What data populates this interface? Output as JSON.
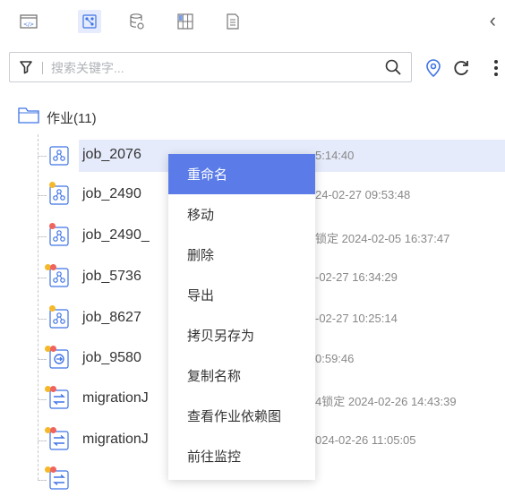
{
  "toolbar": {
    "tabs": [
      {
        "icon": "code-window-icon"
      },
      {
        "icon": "workflow-icon",
        "active": true
      },
      {
        "icon": "database-icon"
      },
      {
        "icon": "grid-table-icon"
      },
      {
        "icon": "document-icon"
      }
    ],
    "collapse_glyph": "‹"
  },
  "search": {
    "placeholder": "搜索关键字..."
  },
  "folder": {
    "label": "作业(11)"
  },
  "jobs": [
    {
      "name": "job_2076",
      "meta": "5:14:40",
      "icon": "workflow-icon",
      "badges": [],
      "selected": true
    },
    {
      "name": "job_2490",
      "meta": "24-02-27 09:53:48",
      "icon": "workflow-icon",
      "badges": [
        "#f5b82a"
      ]
    },
    {
      "name": "job_2490_",
      "meta": "锁定  2024-02-05 16:37:47",
      "icon": "workflow-icon",
      "badges": [
        "#f0645e"
      ]
    },
    {
      "name": "job_5736",
      "meta": "-02-27 16:34:29",
      "icon": "workflow-icon",
      "badges": [
        "#f5b82a",
        "#f0645e"
      ]
    },
    {
      "name": "job_8627",
      "meta": "-02-27 10:25:14",
      "icon": "workflow-icon",
      "badges": [
        "#f5b82a"
      ]
    },
    {
      "name": "job_9580",
      "meta": "0:59:46",
      "icon": "realtime-icon",
      "badges": [
        "#f5b82a",
        "#f0645e"
      ]
    },
    {
      "name": "migrationJ",
      "meta": "4锁定  2024-02-26 14:43:39",
      "icon": "migration-icon",
      "badges": [
        "#f5b82a",
        "#f0645e"
      ]
    },
    {
      "name": "migrationJ",
      "meta": "024-02-26 11:05:05",
      "icon": "migration-icon",
      "badges": [
        "#f5b82a",
        "#f0645e"
      ]
    },
    {
      "name": "",
      "meta": "",
      "icon": "migration-icon",
      "badges": [
        "#f5b82a",
        "#f0645e"
      ]
    }
  ],
  "context_menu": {
    "items": [
      "重命名",
      "移动",
      "删除",
      "导出",
      "拷贝另存为",
      "复制名称",
      "查看作业依赖图",
      "前往监控"
    ],
    "active_index": 0
  },
  "colors": {
    "accent": "#5b7ce8",
    "icon_blue": "#3f73e6",
    "badge_orange": "#f5b82a",
    "badge_red": "#f0645e"
  }
}
